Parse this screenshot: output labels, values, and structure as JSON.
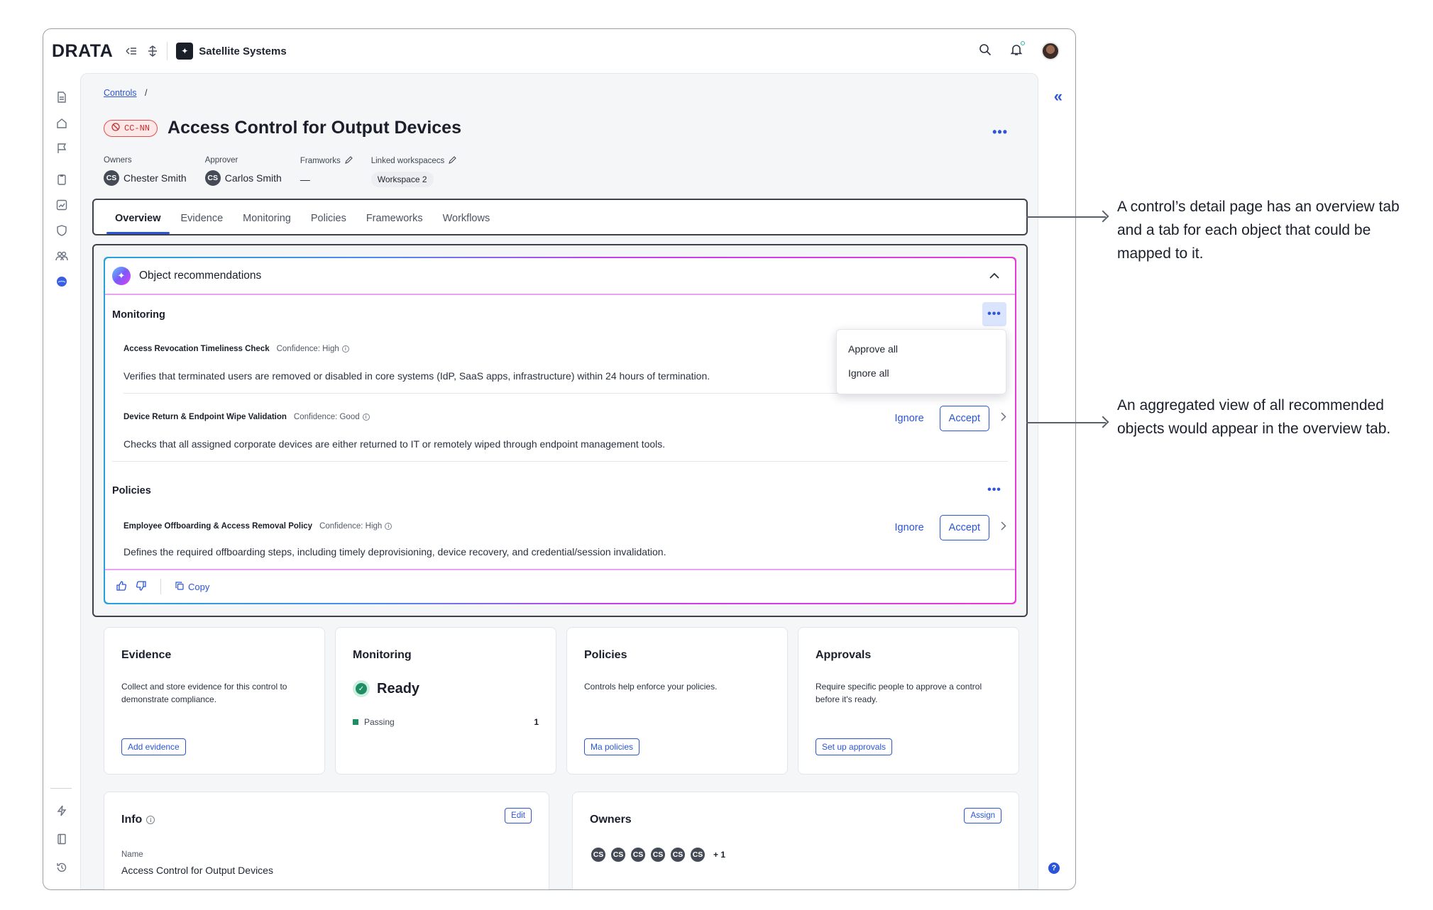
{
  "app": {
    "logo": "DRATA",
    "workspace_name": "Satellite Systems"
  },
  "breadcrumb": {
    "link": "Controls",
    "sep": "/"
  },
  "control": {
    "code": "CC-NN",
    "title": "Access Control for Output Devices"
  },
  "meta": {
    "owners_label": "Owners",
    "owners_initials": "CS",
    "owners_value": "Chester Smith",
    "approver_label": "Approver",
    "approver_initials": "CS",
    "approver_value": "Carlos Smith",
    "frameworks_label": "Framworks",
    "frameworks_value": "—",
    "linked_label": "Linked workspacecs",
    "linked_value": "Workspace 2"
  },
  "tabs": [
    "Overview",
    "Evidence",
    "Monitoring",
    "Policies",
    "Frameworks",
    "Workflows"
  ],
  "recommendations": {
    "title": "Object recommendations",
    "monitoring_title": "Monitoring",
    "policies_title": "Policies",
    "dropdown": {
      "approve_all": "Approve all",
      "ignore_all": "Ignore all"
    },
    "items": [
      {
        "name": "Access Revocation Timeliness Check",
        "confidence": "Confidence: High",
        "desc": "Verifies that terminated users are removed or disabled in core systems (IdP, SaaS apps, infrastructure) within 24 hours of termination."
      },
      {
        "name": "Device Return & Endpoint Wipe Validation",
        "confidence": "Confidence: Good",
        "desc": "Checks that all assigned corporate devices are either returned to IT or remotely wiped through endpoint management tools."
      },
      {
        "name": "Employee Offboarding & Access Removal Policy",
        "confidence": "Confidence: High",
        "desc": "Defines the required offboarding steps, including timely deprovisioning, device recovery, and credential/session invalidation."
      }
    ],
    "ignore_label": "Ignore",
    "accept_label": "Accept",
    "copy_label": "Copy"
  },
  "cards": {
    "evidence": {
      "title": "Evidence",
      "desc": "Collect and store evidence for this control to demonstrate compliance.",
      "button": "Add evidence"
    },
    "monitoring": {
      "title": "Monitoring",
      "status": "Ready",
      "passing_label": "Passing",
      "passing_count": "1"
    },
    "policies": {
      "title": "Policies",
      "desc": "Controls help enforce your policies.",
      "button": "Ma policies"
    },
    "approvals": {
      "title": "Approvals",
      "desc": "Require specific people to approve a control before it's ready.",
      "button": "Set up approvals"
    }
  },
  "info": {
    "title": "Info",
    "edit": "Edit",
    "name_label": "Name",
    "name_value": "Access Control for Output Devices"
  },
  "owners": {
    "title": "Owners",
    "assign": "Assign",
    "initials": [
      "CS",
      "CS",
      "CS",
      "CS",
      "CS",
      "CS"
    ],
    "more": "+ 1"
  },
  "annotations": {
    "first": "A control’s detail page has an overview tab and a tab for each object that could be mapped to it.",
    "second": "An aggregated view of all recommended objects would appear in the overview tab."
  },
  "icons": {
    "top": [
      "collapse-menu-icon",
      "move-icon",
      "search-icon",
      "bell-icon"
    ],
    "rail": [
      "document-icon",
      "home-icon",
      "flag-icon",
      "clipboard-icon",
      "chart-icon",
      "shield-icon",
      "people-icon",
      "ai-icon",
      "bolt-icon",
      "book-icon",
      "history-icon",
      "settings-icon"
    ]
  },
  "colors": {
    "accent": "#2b54d9",
    "status_red": "#e24d4d",
    "success": "#1e8f63"
  }
}
